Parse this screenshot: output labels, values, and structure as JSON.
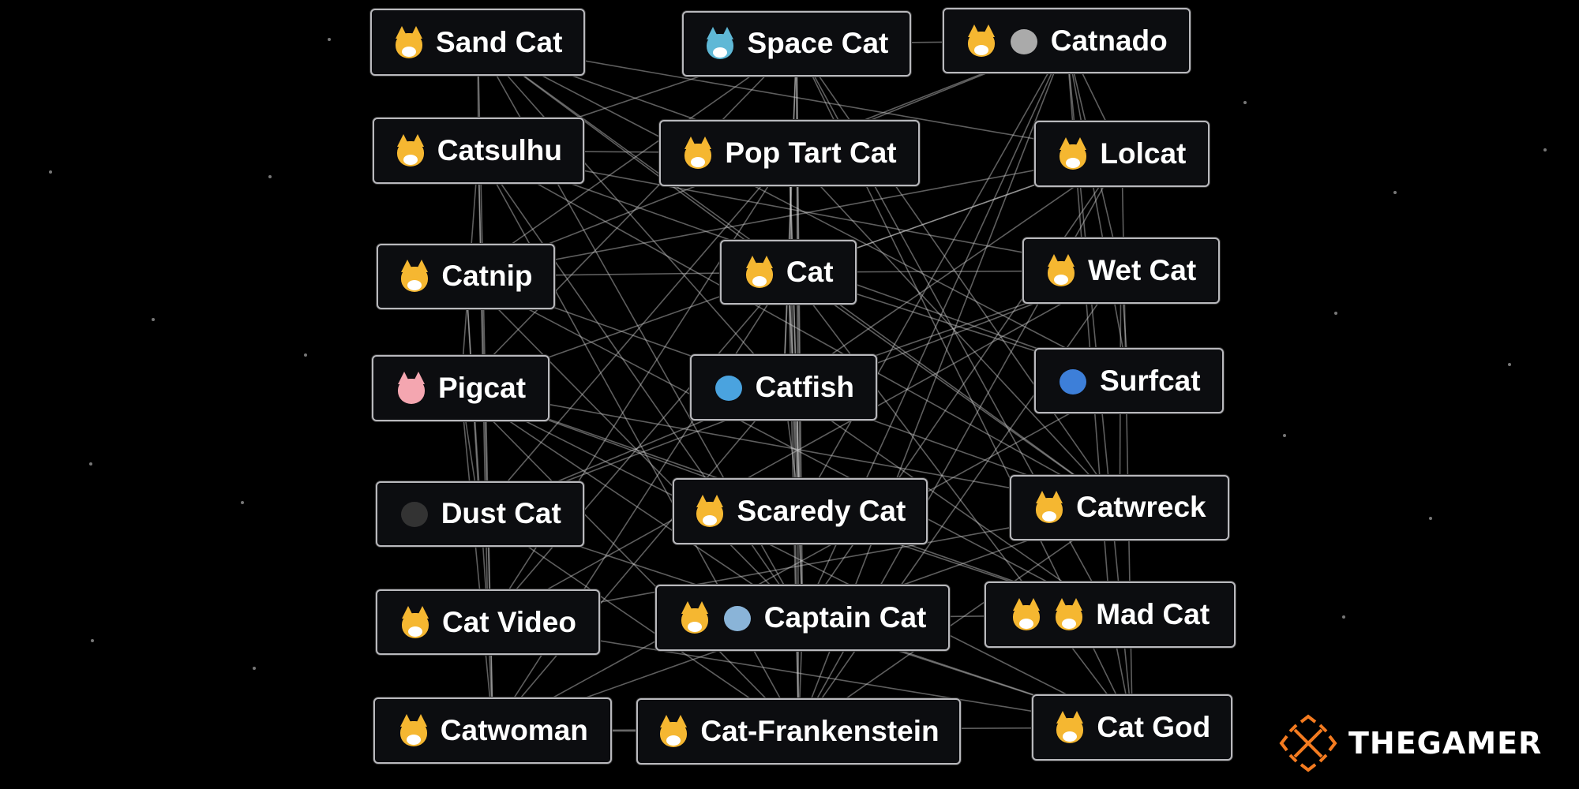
{
  "nodes": [
    {
      "label": "Sand Cat",
      "icons": [
        "cat-face"
      ]
    },
    {
      "label": "Space Cat",
      "icons": [
        "astronaut-cat"
      ]
    },
    {
      "label": "Catnado",
      "icons": [
        "cat-face",
        "tornado"
      ]
    },
    {
      "label": "Catsulhu",
      "icons": [
        "cat-face"
      ]
    },
    {
      "label": "Pop Tart Cat",
      "icons": [
        "cat-face"
      ]
    },
    {
      "label": "Lolcat",
      "icons": [
        "cat-face"
      ]
    },
    {
      "label": "Catnip",
      "icons": [
        "cat-face"
      ]
    },
    {
      "label": "Cat",
      "icons": [
        "cat"
      ]
    },
    {
      "label": "Wet Cat",
      "icons": [
        "cat-face"
      ]
    },
    {
      "label": "Pigcat",
      "icons": [
        "pig-face"
      ]
    },
    {
      "label": "Catfish",
      "icons": [
        "fish"
      ]
    },
    {
      "label": "Surfcat",
      "icons": [
        "surfer"
      ]
    },
    {
      "label": "Dust Cat",
      "icons": [
        "ninja"
      ]
    },
    {
      "label": "Scaredy Cat",
      "icons": [
        "scared-cat"
      ]
    },
    {
      "label": "Catwreck",
      "icons": [
        "cat"
      ]
    },
    {
      "label": "Cat Video",
      "icons": [
        "cat-face"
      ]
    },
    {
      "label": "Captain Cat",
      "icons": [
        "cat-face",
        "airplane"
      ]
    },
    {
      "label": "Mad Cat",
      "icons": [
        "cat-face",
        "angry-cat"
      ]
    },
    {
      "label": "Catwoman",
      "icons": [
        "cat-face"
      ]
    },
    {
      "label": "Cat-Frankenstein",
      "icons": [
        "cat"
      ]
    },
    {
      "label": "Cat God",
      "icons": [
        "cat-face"
      ]
    }
  ],
  "logo": {
    "text": "THEGAMER",
    "color": "#f47b20"
  },
  "colors": {
    "background": "#000000",
    "node_bg": "#0c0d10",
    "node_border": "#b9b9bd",
    "edge": "#d0d0d0",
    "cat": "#f5b731"
  }
}
